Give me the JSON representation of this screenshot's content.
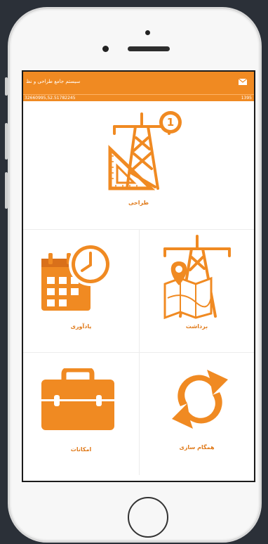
{
  "app": {
    "title": "سیستم جامع طراحی و نظ",
    "coordinates": "32660995,52.51782245",
    "right_number": "1395",
    "mail_icon": "mail-icon"
  },
  "tiles": {
    "design": {
      "label": "طراحی",
      "badge": "1",
      "icon": "tower-ruler-icon"
    },
    "reminder": {
      "label": "یادآوری",
      "icon": "calendar-clock-icon"
    },
    "harvest": {
      "label": "برداشت",
      "icon": "tower-map-icon"
    },
    "facilities": {
      "label": "امکانات",
      "icon": "toolbox-icon"
    },
    "sync": {
      "label": "همگام سازی",
      "icon": "sync-icon"
    }
  },
  "colors": {
    "accent": "#f08a22",
    "background": "#2b3038"
  }
}
